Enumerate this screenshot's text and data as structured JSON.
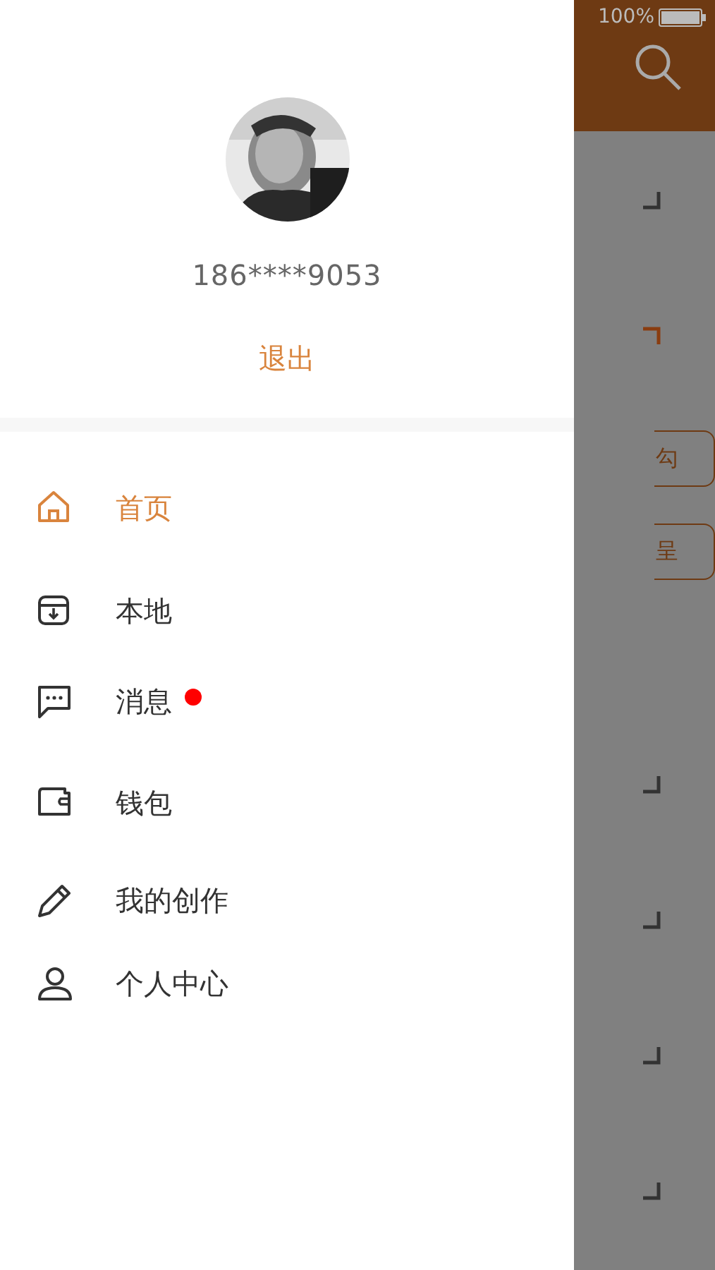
{
  "profile": {
    "phone": "186****9053",
    "logout": "退出"
  },
  "menu": [
    {
      "label": "首页",
      "kind": "home",
      "selected": true,
      "badge": false
    },
    {
      "label": "本地",
      "kind": "box",
      "selected": false,
      "badge": false
    },
    {
      "label": "消息",
      "kind": "chat",
      "selected": false,
      "badge": true
    },
    {
      "label": "钱包",
      "kind": "wallet",
      "selected": false,
      "badge": false
    },
    {
      "label": "我的创作",
      "kind": "pencil",
      "selected": false,
      "badge": false
    },
    {
      "label": "个人中心",
      "kind": "person",
      "selected": false,
      "badge": false
    }
  ],
  "background": {
    "status_battery": "100%",
    "buttons": [
      "勾",
      "呈"
    ],
    "marks": [
      {
        "kind": "bottom",
        "color": "#333333"
      },
      {
        "kind": "top",
        "color": "#8a3d10"
      },
      {
        "kind": "bottom",
        "color": "#333333"
      },
      {
        "kind": "bottom",
        "color": "#333333"
      },
      {
        "kind": "bottom",
        "color": "#333333"
      },
      {
        "kind": "bottom",
        "color": "#333333"
      }
    ]
  }
}
